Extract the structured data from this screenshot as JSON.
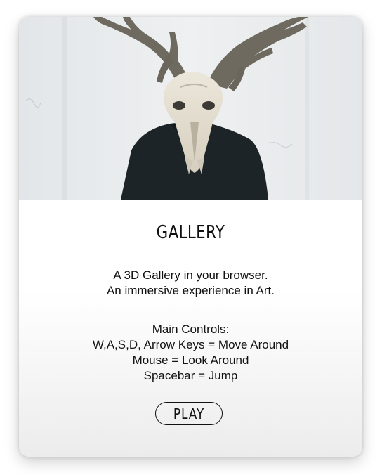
{
  "card": {
    "image": {
      "description": "person with deer skull head"
    },
    "title": "GALLERY",
    "intro_lines": [
      "A 3D Gallery in your browser.",
      "An immersive experience in Art."
    ],
    "controls_lines": [
      "Main Controls:",
      "W,A,S,D, Arrow Keys = Move Around",
      "Mouse = Look Around",
      "Spacebar = Jump"
    ],
    "play_label": "PLAY"
  },
  "colors": {
    "text": "#111111",
    "wall": "#e9ecee",
    "coat": "#1c2427",
    "bone": "#e6e0d2",
    "antler": "#6e6a5f"
  }
}
